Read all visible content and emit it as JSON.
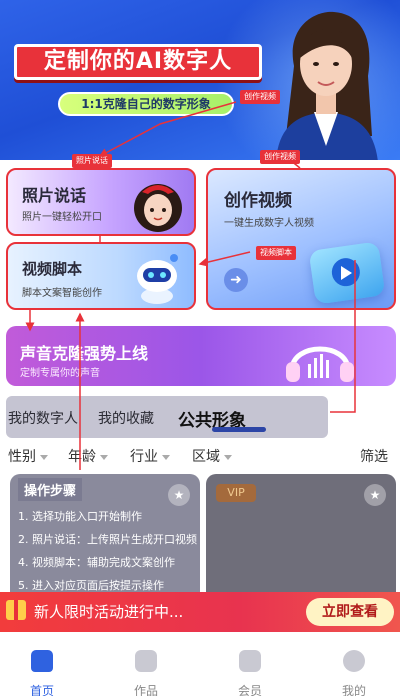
{
  "hero": {
    "title": "定制你的AI数字人",
    "subtitle": "1:1克隆自己的数字形象",
    "tag": "创作视频"
  },
  "cards": {
    "photo": {
      "title": "照片说话",
      "subtitle": "照片一键轻松开口",
      "tag": "照片说话"
    },
    "video": {
      "title": "创作视频",
      "subtitle": "一键生成数字人视频",
      "tag": "创作视频",
      "arrow_icon": "arrow-right-icon"
    },
    "script": {
      "title": "视频脚本",
      "subtitle": "脚本文案智能创作",
      "tag": "视频脚本"
    },
    "voice": {
      "title": "声音克隆强势上线",
      "subtitle": "定制专属你的声音"
    }
  },
  "tabs": [
    "我的数字人",
    "我的收藏",
    "公共形象"
  ],
  "active_tab": "公共形象",
  "filters": [
    "性别",
    "年龄",
    "行业",
    "区域"
  ],
  "filter_action": "筛选",
  "gallery": {
    "vip_badge": "VIP"
  },
  "steps": {
    "title": "操作步骤",
    "items": [
      "1. 选择功能入口开始制作",
      "2. 照片说话：上传照片生成开口视频",
      "4. 视频脚本：辅助完成文案创作",
      "5. 进入对应页面后按提示操作"
    ]
  },
  "promo": {
    "text": "新人限时活动进行中...",
    "button": "立即查看"
  },
  "nav": [
    {
      "label": "首页",
      "icon": "home-icon"
    },
    {
      "label": "作品",
      "icon": "works-icon"
    },
    {
      "label": "会员",
      "icon": "crown-icon"
    },
    {
      "label": "我的",
      "icon": "profile-icon"
    }
  ],
  "colors": {
    "accent": "#2f62e0",
    "annotation": "#e8323a",
    "hero_bg": "#2f63e8",
    "promo_bg": "#f23c3c"
  }
}
